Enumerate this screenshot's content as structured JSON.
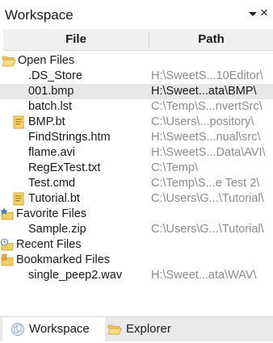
{
  "panel": {
    "title": "Workspace",
    "close_glyph": "×",
    "menu_icon": "dropdown-arrow-icon"
  },
  "columns": {
    "file": "File",
    "path": "Path"
  },
  "tree": {
    "open_files": {
      "label": "Open Files",
      "icon": "open-folder-icon",
      "items": [
        {
          "name": ".DS_Store",
          "path": "H:\\SweetS...10Editor\\",
          "icon": "none",
          "selected": false
        },
        {
          "name": "001.bmp",
          "path": "H:\\Sweet...ata\\BMP\\",
          "icon": "none",
          "selected": true
        },
        {
          "name": "batch.lst",
          "path": "C:\\Temp\\S...nvertSrc\\",
          "icon": "none",
          "selected": false
        },
        {
          "name": "BMP.bt",
          "path": "C:\\Users\\...pository\\",
          "icon": "template-file-icon",
          "selected": false
        },
        {
          "name": "FindStrings.htm",
          "path": "H:\\SweetS...nual\\src\\",
          "icon": "none",
          "selected": false
        },
        {
          "name": "flame.avi",
          "path": "H:\\SweetS...Data\\AVI\\",
          "icon": "none",
          "selected": false
        },
        {
          "name": "RegExTest.txt",
          "path": "C:\\Temp\\",
          "icon": "none",
          "selected": false
        },
        {
          "name": "Test.cmd",
          "path": "C:\\Temp\\S...e Test 2\\",
          "icon": "none",
          "selected": false
        },
        {
          "name": "Tutorial.bt",
          "path": "C:\\Users\\G...\\Tutorial\\",
          "icon": "template-file-icon",
          "selected": false
        }
      ]
    },
    "favorite_files": {
      "label": "Favorite Files",
      "icon": "favorite-folder-icon",
      "items": [
        {
          "name": "Sample.zip",
          "path": "C:\\Users\\G...\\Tutorial\\"
        }
      ]
    },
    "recent_files": {
      "label": "Recent Files",
      "icon": "recent-folder-icon"
    },
    "bookmarked_files": {
      "label": "Bookmarked Files",
      "icon": "bookmark-folder-icon",
      "items": [
        {
          "name": "single_peep2.wav",
          "path": "H:\\Sweet...ata\\WAV\\"
        }
      ]
    }
  },
  "tabs": [
    {
      "label": "Workspace",
      "icon": "workspace-icon",
      "active": true
    },
    {
      "label": "Explorer",
      "icon": "explorer-folder-icon",
      "active": false
    }
  ],
  "colors": {
    "selection": "#e7e7e7",
    "path_text": "#8c8c8c",
    "folder_yellow": "#f5c542",
    "tab_bar": "#e9e9e9"
  }
}
